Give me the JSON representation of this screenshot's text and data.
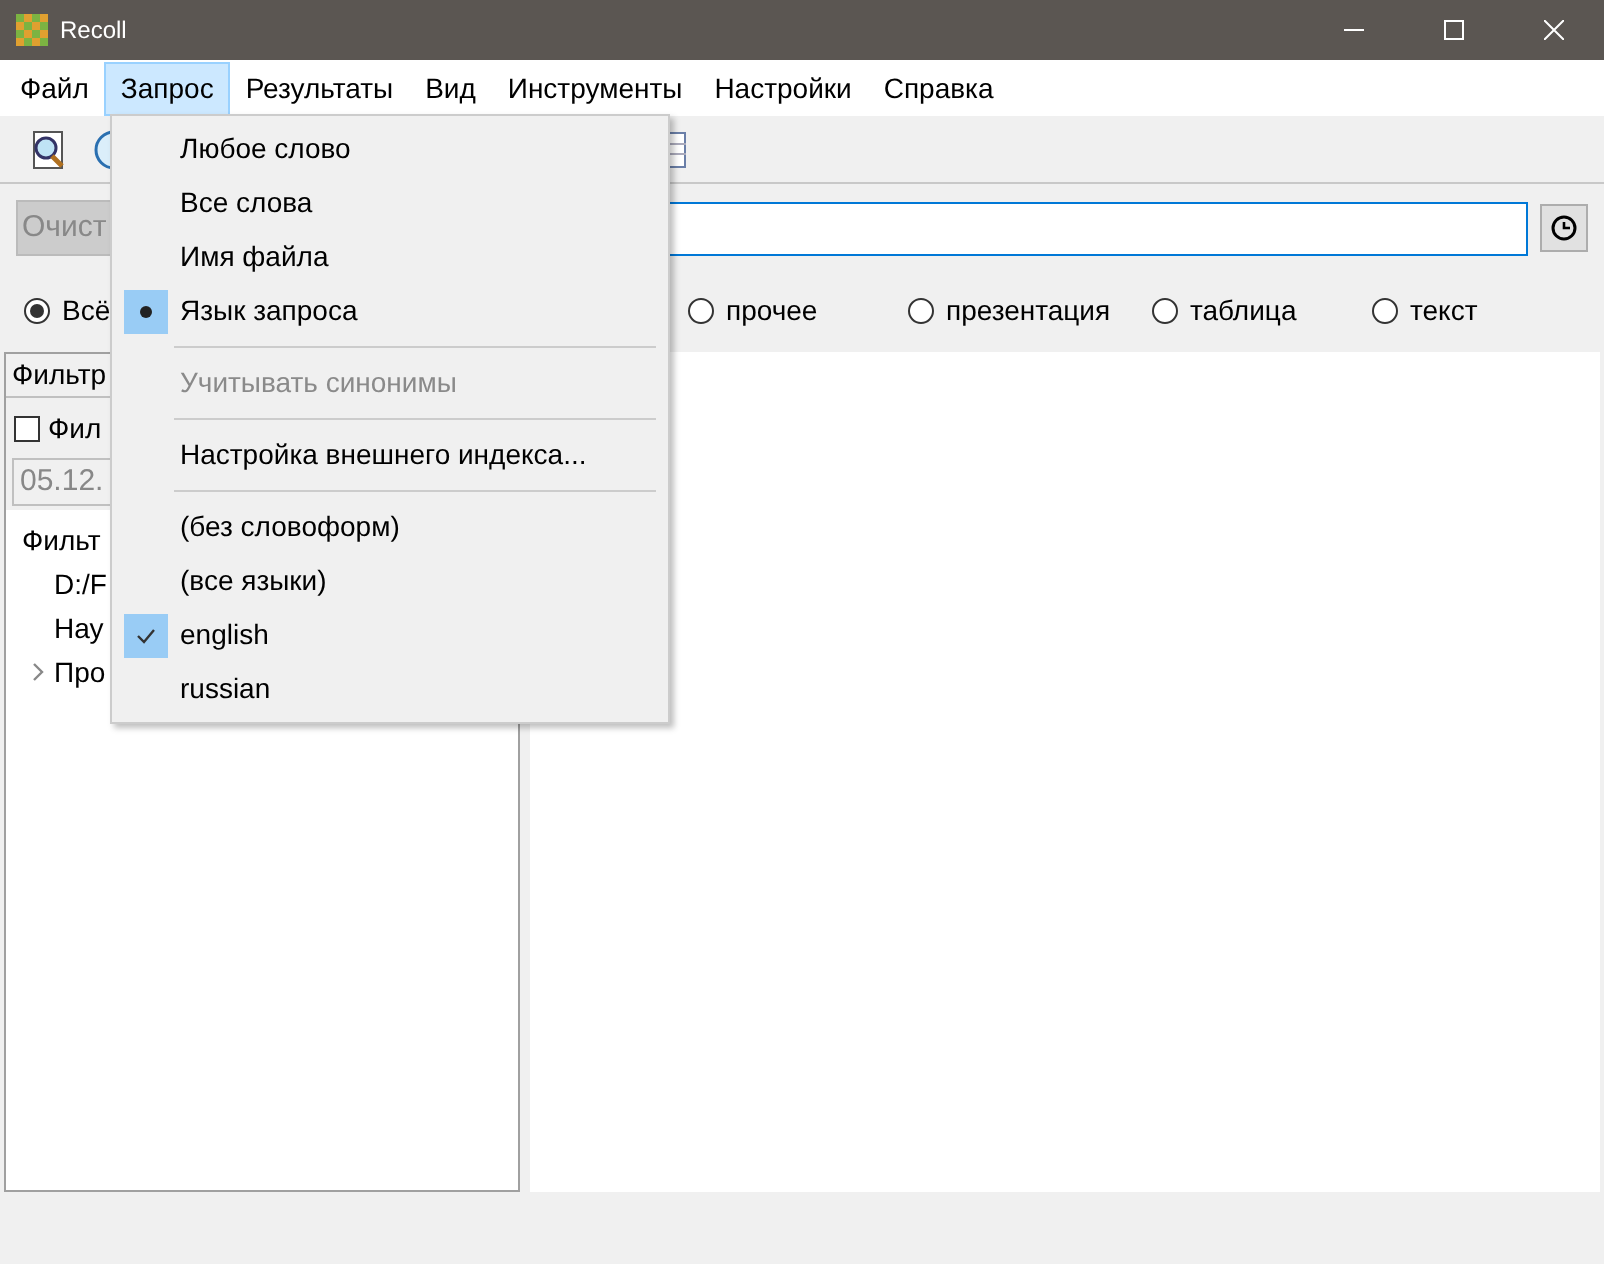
{
  "window": {
    "title": "Recoll"
  },
  "menubar": [
    {
      "label": "Файл",
      "selected": false
    },
    {
      "label": "Запрос",
      "selected": true
    },
    {
      "label": "Результаты",
      "selected": false
    },
    {
      "label": "Вид",
      "selected": false
    },
    {
      "label": "Инструменты",
      "selected": false
    },
    {
      "label": "Настройки",
      "selected": false
    },
    {
      "label": "Справка",
      "selected": false
    }
  ],
  "search": {
    "clear_button": "Очист"
  },
  "doc_types": [
    {
      "label": "Всё",
      "selected": true
    },
    {
      "label": "прочее",
      "selected": false
    },
    {
      "label": "презентация",
      "selected": false
    },
    {
      "label": "таблица",
      "selected": false
    },
    {
      "label": "текст",
      "selected": false
    }
  ],
  "filter_panel": {
    "header": "Фильтр",
    "date_filter": {
      "label": "Фил",
      "checked": false
    },
    "date_value": "05.12.",
    "tree": [
      {
        "label": "Фильт",
        "children": [
          {
            "label": "D:/F"
          },
          {
            "label": "Нау"
          },
          {
            "label": "Про",
            "expanded": false
          }
        ]
      }
    ]
  },
  "dropdown": [
    {
      "kind": "action",
      "label": "Любое слово",
      "disabled": false
    },
    {
      "kind": "action",
      "label": "Все слова",
      "disabled": false
    },
    {
      "kind": "action",
      "label": "Имя файла",
      "disabled": false
    },
    {
      "kind": "radio",
      "label": "Язык запроса",
      "selected": true,
      "disabled": false
    },
    {
      "kind": "separator"
    },
    {
      "kind": "action",
      "label": "Учитывать синонимы",
      "disabled": true
    },
    {
      "kind": "separator"
    },
    {
      "kind": "action",
      "label": "Настройка внешнего индекса...",
      "disabled": false
    },
    {
      "kind": "separator"
    },
    {
      "kind": "check",
      "label": "(без словоформ)",
      "checked": false,
      "disabled": false
    },
    {
      "kind": "check",
      "label": "(все языки)",
      "checked": false,
      "disabled": false
    },
    {
      "kind": "check",
      "label": "english",
      "checked": true,
      "disabled": false
    },
    {
      "kind": "check",
      "label": "russian",
      "checked": false,
      "disabled": false
    }
  ]
}
